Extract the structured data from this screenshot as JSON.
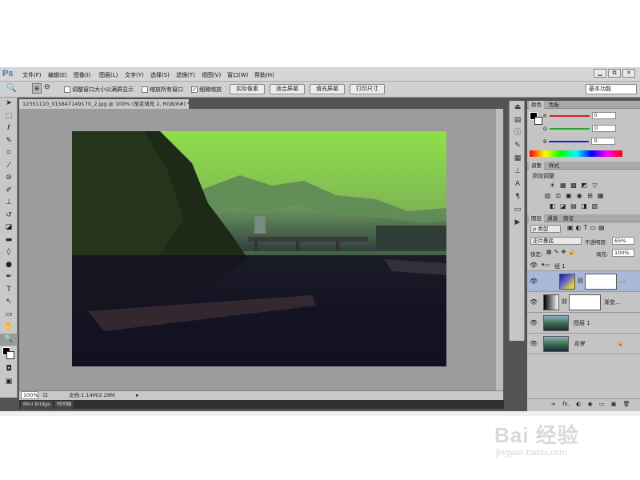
{
  "app": {
    "logo": "Ps"
  },
  "menu": [
    "文件(F)",
    "编辑(E)",
    "图像(I)",
    "图层(L)",
    "文字(Y)",
    "选择(S)",
    "滤镜(T)",
    "视图(V)",
    "窗口(W)",
    "帮助(H)"
  ],
  "window_controls": [
    "▁",
    "⧉",
    "✕"
  ],
  "options": {
    "checks": [
      {
        "label": "调整窗口大小以满屏显示",
        "checked": false
      },
      {
        "label": "缩放所有窗口",
        "checked": false
      },
      {
        "label": "细微缩放",
        "checked": true
      }
    ],
    "buttons": [
      "实际像素",
      "适合屏幕",
      "填充屏幕",
      "打印尺寸"
    ],
    "workspace": "基本功能"
  },
  "document": {
    "tab_title": "12351110_015847149170_2.jpg @ 100% (渐变填充 2, RGB/8#) *",
    "zoom": "100%",
    "doc_info": "文档:1.14M/2.28M"
  },
  "bottom_tabs": [
    "Mini Bridge",
    "时间轴"
  ],
  "color_panel": {
    "tabs": [
      "颜色",
      "色板"
    ],
    "channels": [
      {
        "label": "R",
        "value": "0",
        "color": "#cc2222"
      },
      {
        "label": "G",
        "value": "0",
        "color": "#22aa22"
      },
      {
        "label": "B",
        "value": "0",
        "color": "#2222cc"
      }
    ]
  },
  "adjust_panel": {
    "tabs": [
      "调整",
      "样式"
    ],
    "title": "添加调整",
    "icons_row1": [
      "☀",
      "▦",
      "▩",
      "◩",
      "▽"
    ],
    "icons_row2": [
      "▥",
      "⚖",
      "▣",
      "◉",
      "⊞",
      "▦"
    ],
    "icons_row3": [
      "◧",
      "◪",
      "▤",
      "◨",
      "▧"
    ]
  },
  "layers_panel": {
    "tabs": [
      "图层",
      "通道",
      "路径"
    ],
    "filter_label": "ρ 类型",
    "blend_mode": "正片叠底",
    "opacity_label": "不透明度:",
    "opacity": "65%",
    "lock_label": "锁定:",
    "fill_label": "填充:",
    "fill": "100%",
    "layers": [
      {
        "name": "组 1",
        "type": "group"
      },
      {
        "name": "...",
        "type": "gradient-selected"
      },
      {
        "name": "渐变...",
        "type": "gradient"
      },
      {
        "name": "图层 1",
        "type": "image"
      },
      {
        "name": "背景",
        "type": "background"
      }
    ],
    "footer_icons": [
      "∞",
      "fx.",
      "◐",
      "◉",
      "▭",
      "▣",
      "🗑"
    ]
  },
  "watermark": {
    "brand": "Bai 经验",
    "url": "jingyan.baidu.com"
  }
}
